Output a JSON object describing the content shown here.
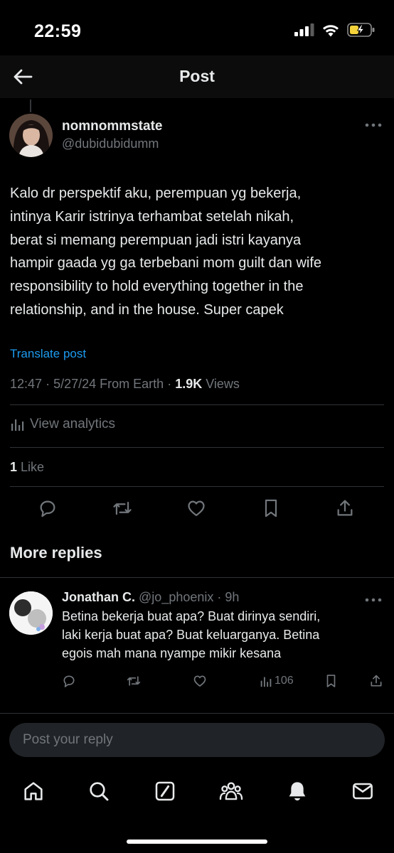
{
  "status_bar": {
    "time": "22:59"
  },
  "header": {
    "title": "Post"
  },
  "post": {
    "author_name": "nomnommstate",
    "author_handle": "@dubidubidumm",
    "lines": [
      "Kalo dr perspektif aku, perempuan yg bekerja,",
      "intinya Karir istrinya terhambat setelah nikah,",
      "berat si memang perempuan jadi istri kayanya",
      "hampir gaada yg ga terbebani mom guilt dan wife",
      "responsibility to hold everything together in the",
      "relationship, and in the house. Super capek"
    ],
    "translate_label": "Translate post",
    "time": "12:47",
    "date": "5/27/24",
    "source": "From Earth",
    "views_count": "1.9K",
    "views_label": "Views",
    "analytics_label": "View analytics",
    "likes_count": "1",
    "likes_label": "Like"
  },
  "more_replies": {
    "title": "More replies"
  },
  "reply": {
    "name": "Jonathan C.",
    "handle": "@jo_phoenix",
    "age": "9h",
    "lines": [
      "Betina bekerja buat apa? Buat dirinya sendiri,",
      "laki kerja buat apa? Buat keluarganya. Betina",
      "egois mah mana nyampe mikir kesana"
    ],
    "views": "106"
  },
  "reply_input": {
    "placeholder": "Post your reply"
  },
  "icons": {
    "nav": [
      "home-icon",
      "search-icon",
      "grok-icon",
      "communities-icon",
      "notifications-icon",
      "messages-icon"
    ],
    "actions": [
      "reply-icon",
      "repost-icon",
      "like-icon",
      "bookmark-icon",
      "share-icon"
    ]
  },
  "colors": {
    "background": "#000000",
    "text": "#e7e9ea",
    "muted": "#71767b",
    "accent": "#1d9bf0",
    "divider": "#2f3336",
    "battery": "#f3d23a"
  }
}
